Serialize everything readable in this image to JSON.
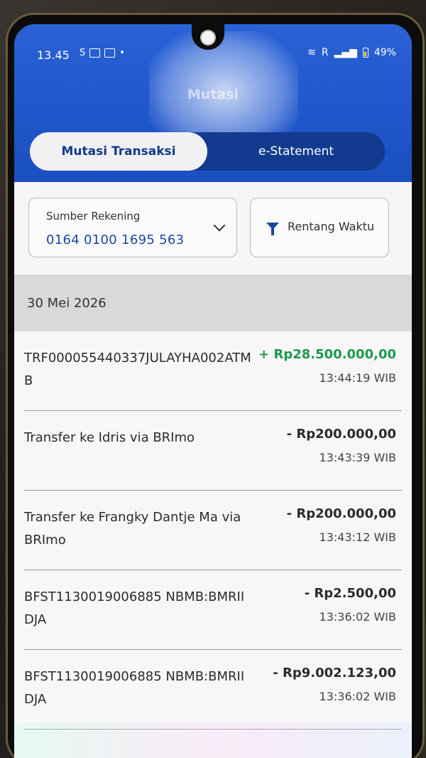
{
  "status_bar": {
    "time": "13.45",
    "network": "R",
    "battery": "49%"
  },
  "header": {
    "title": "Mutasi"
  },
  "tabs": [
    {
      "label": "Mutasi Transaksi",
      "active": true
    },
    {
      "label": "e-Statement",
      "active": false
    }
  ],
  "filters": {
    "account_label": "Sumber Rekening",
    "account_number": "0164 0100 1695 563",
    "range_label": "Rentang Waktu"
  },
  "date_group": "30 Mei 2026",
  "transactions": [
    {
      "description": "TRF000055440337JULAYHA002ATMB",
      "amount": "+ Rp28.500.000,00",
      "time": "13:44:19 WIB",
      "type": "credit"
    },
    {
      "description": "Transfer ke Idris via BRImo",
      "amount": "- Rp200.000,00",
      "time": "13:43:39 WIB",
      "type": "debit"
    },
    {
      "description": "Transfer ke Frangky Dantje Ma via BRImo",
      "amount": "- Rp200.000,00",
      "time": "13:43:12 WIB",
      "type": "debit"
    },
    {
      "description": "BFST1130019006885 NBMB:BMRIIDJA",
      "amount": "- Rp2.500,00",
      "time": "13:36:02 WIB",
      "type": "debit"
    },
    {
      "description": "BFST1130019006885 NBMB:BMRIIDJA",
      "amount": "- Rp9.002.123,00",
      "time": "13:36:02 WIB",
      "type": "debit"
    }
  ],
  "colors": {
    "brand_blue": "#1f56c9",
    "tab_dark": "#123a8f",
    "credit_green": "#1b9a4a",
    "account_blue": "#1a47a3"
  },
  "icons": {
    "dropdown": "chevron-down-icon",
    "filter": "filter-icon"
  }
}
